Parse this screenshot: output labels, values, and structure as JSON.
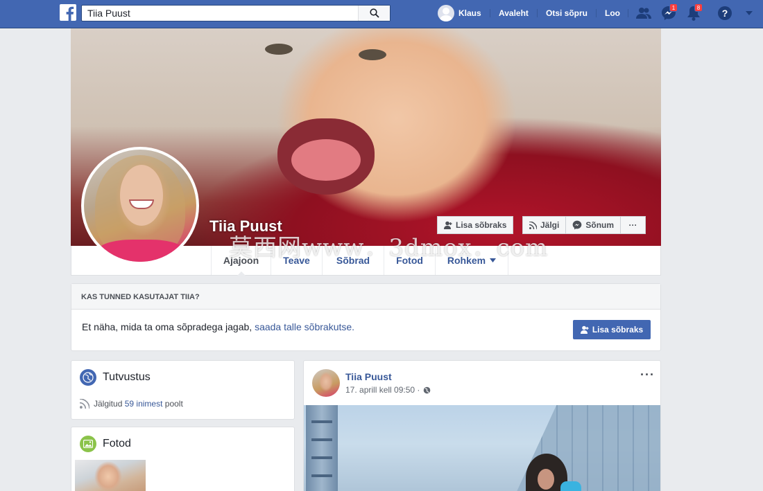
{
  "topbar": {
    "search_value": "Tiia Puust",
    "user_name": "Klaus",
    "nav_links": [
      "Avaleht",
      "Otsi sõpru",
      "Loo"
    ],
    "messages_badge": "1",
    "notifications_badge": "8",
    "brand_color": "#4267b2"
  },
  "profile": {
    "name": "Tiia Puust",
    "actions": {
      "add_friend": "Lisa sõbraks",
      "follow": "Jälgi",
      "message": "Sõnum",
      "more": "···"
    },
    "tabs": [
      "Ajajoon",
      "Teave",
      "Sõbrad",
      "Fotod",
      "Rohkem"
    ]
  },
  "friend_prompt": {
    "heading": "KAS TUNNED KASUTAJAT TIIA?",
    "text": "Et näha, mida ta oma sõpradega jagab,",
    "link": "saada talle sõbrakutse.",
    "button": "Lisa sõbraks"
  },
  "intro": {
    "title": "Tutvustus",
    "followed_prefix": "Jälgitud",
    "followed_link": "59 inimest",
    "followed_suffix": "poolt"
  },
  "photos": {
    "title": "Fotod"
  },
  "post": {
    "author": "Tiia Puust",
    "timestamp": "17. aprill kell 09:50 ·",
    "more": "···"
  },
  "watermark": "莫西网www．3dmox．com"
}
